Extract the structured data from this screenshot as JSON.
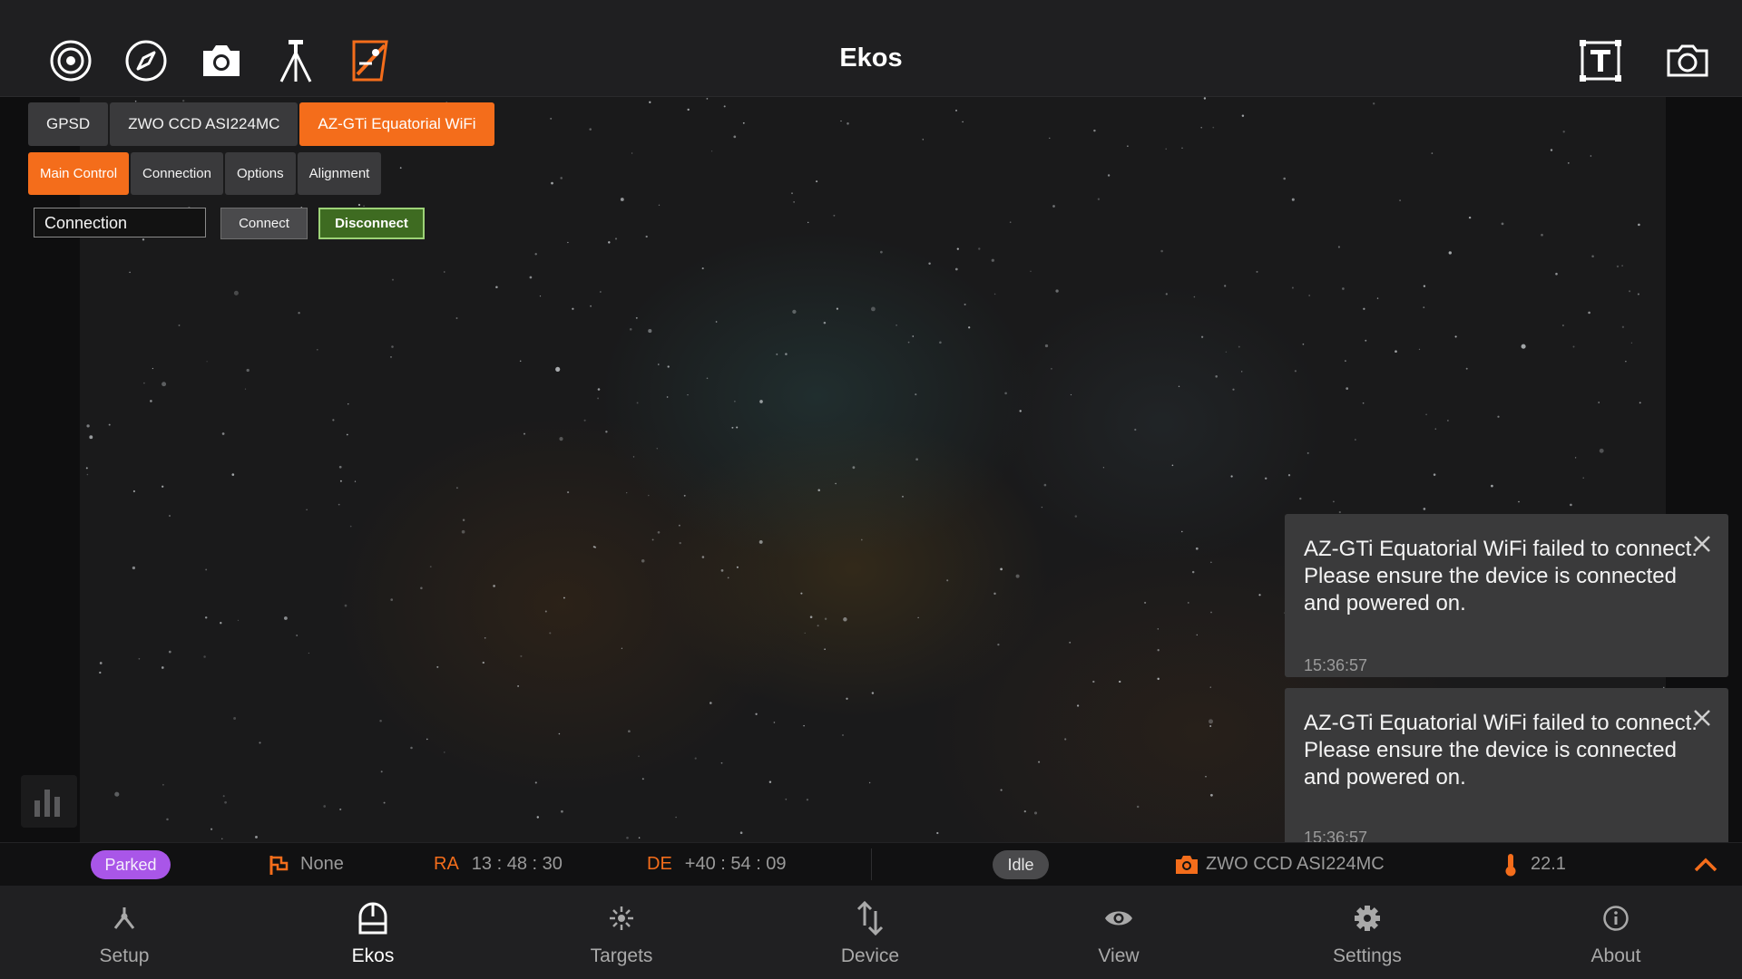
{
  "app": {
    "title": "Ekos"
  },
  "device_tabs": [
    {
      "label": "GPSD",
      "active": false
    },
    {
      "label": "ZWO CCD ASI224MC",
      "active": false
    },
    {
      "label": "AZ-GTi Equatorial WiFi",
      "active": true
    }
  ],
  "sub_tabs": [
    {
      "label": "Main Control",
      "active": true
    },
    {
      "label": "Connection",
      "active": false
    },
    {
      "label": "Options",
      "active": false
    },
    {
      "label": "Alignment",
      "active": false
    }
  ],
  "connection": {
    "label": "Connection",
    "connect_label": "Connect",
    "disconnect_label": "Disconnect"
  },
  "notifications": [
    {
      "message": "AZ-GTi Equatorial WiFi failed to connect.\nPlease ensure the device is connected and powered on.",
      "time": "15:36:57"
    },
    {
      "message": "AZ-GTi Equatorial WiFi failed to connect.\nPlease ensure the device is connected and powered on.",
      "time": "15:36:57"
    }
  ],
  "status": {
    "mount_state": "Parked",
    "target": "None",
    "ra_label": "RA",
    "ra_value": "13 : 48 : 30",
    "de_label": "DE",
    "de_value": "+40 : 54 : 09",
    "capture_state": "Idle",
    "camera": "ZWO CCD ASI224MC",
    "temperature": "22.1"
  },
  "nav": [
    {
      "label": "Setup",
      "icon": "setup-icon"
    },
    {
      "label": "Ekos",
      "icon": "ekos-icon",
      "active": true
    },
    {
      "label": "Targets",
      "icon": "targets-icon"
    },
    {
      "label": "Device",
      "icon": "device-icon"
    },
    {
      "label": "View",
      "icon": "view-icon"
    },
    {
      "label": "Settings",
      "icon": "settings-icon"
    },
    {
      "label": "About",
      "icon": "about-icon"
    }
  ],
  "colors": {
    "accent": "#f46d1b",
    "disconnect": "#3e6b21",
    "parked": "#a956e8"
  }
}
